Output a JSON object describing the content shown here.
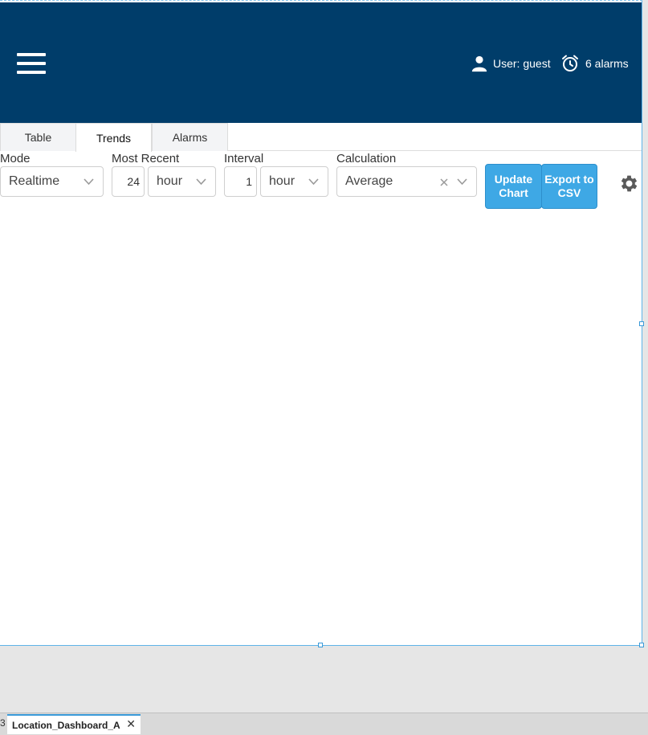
{
  "header": {
    "user_label": "User: guest",
    "alarms_label": "6 alarms",
    "background": "#003d6a"
  },
  "tabs": [
    {
      "label": "Table",
      "active": false
    },
    {
      "label": "Trends",
      "active": true
    },
    {
      "label": "Alarms",
      "active": false
    }
  ],
  "controls": {
    "mode": {
      "label": "Mode",
      "value": "Realtime"
    },
    "most_recent": {
      "label": "Most Recent",
      "amount": "24",
      "unit": "hour"
    },
    "interval": {
      "label": "Interval",
      "amount": "1",
      "unit": "hour"
    },
    "calculation": {
      "label": "Calculation",
      "value": "Average"
    },
    "update_button": {
      "line1": "Update",
      "line2": "Chart"
    },
    "export_button": {
      "line1": "Export to",
      "line2": "CSV"
    }
  },
  "bottom": {
    "document_tab": "Location_Dashboard_A",
    "close_glyph": "✕",
    "left_glyph": "3"
  },
  "colors": {
    "accent": "#3ea8e5",
    "selection": "#5fb4e8"
  },
  "icons": [
    "menu-icon",
    "user-icon",
    "alarm-clock-icon",
    "chevron-down-icon",
    "clear-icon",
    "gear-icon",
    "close-icon"
  ]
}
